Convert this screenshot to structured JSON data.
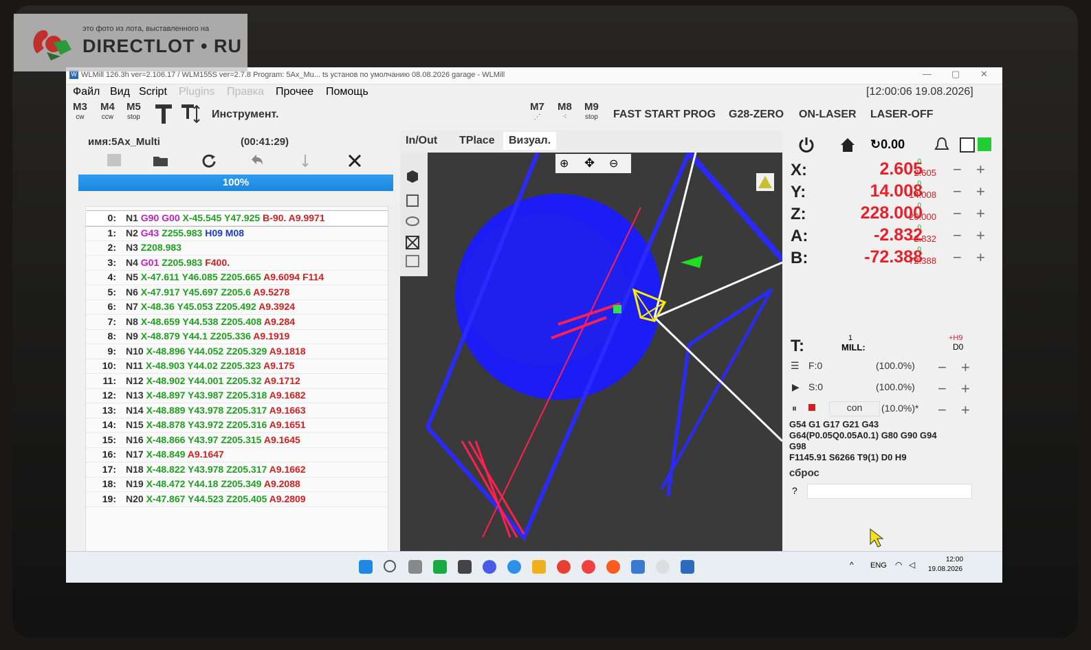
{
  "window": {
    "title": "WLMill 126.3h ver=2.106.17 / WLM155S ver=2.7.8   Program: 5Ax_Mu... ts установ по умолчанию 08.08.2026 garage - WLMill",
    "clock": "[12:00:06 19.08.2026]"
  },
  "menu": [
    "Файл",
    "Вид",
    "Script",
    "Plugins",
    "Правка",
    "Прочее",
    "Помощь"
  ],
  "toolbar": {
    "m3": "M3",
    "m3_sub": "cw",
    "m4": "M4",
    "m4_sub": "ccw",
    "m5": "M5",
    "m5_sub": "stop",
    "tool": "Инструмент.",
    "m7": "M7",
    "m8": "M8",
    "m9": "M9",
    "m9_sub": "stop",
    "fast_start": "FAST START PROG",
    "g28": "G28-ZERO",
    "on_laser": "ON-LASER",
    "laser_off": "LASER-OFF"
  },
  "program": {
    "name": "имя:5Ax_Multi",
    "time": "(00:41:29)",
    "progress": "100%",
    "progress_value": 1.0,
    "line_input": "0",
    "next_label": ">>>"
  },
  "code_lines": [
    {
      "n": "0:",
      "tokens": [
        [
          "N1",
          "n"
        ],
        [
          "G90",
          "g"
        ],
        [
          "G00",
          "g"
        ],
        [
          "X-45.545",
          "x"
        ],
        [
          "Y47.925",
          "y"
        ],
        [
          "B-90.",
          "b"
        ],
        [
          "A9.9971",
          "a"
        ]
      ]
    },
    {
      "n": "1:",
      "tokens": [
        [
          "N2",
          "n"
        ],
        [
          "G43",
          "g"
        ],
        [
          "Z255.983",
          "z"
        ],
        [
          "H09",
          "h"
        ],
        [
          "M08",
          "m"
        ]
      ]
    },
    {
      "n": "2:",
      "tokens": [
        [
          "N3",
          "n"
        ],
        [
          "Z208.983",
          "z"
        ]
      ]
    },
    {
      "n": "3:",
      "tokens": [
        [
          "N4",
          "n"
        ],
        [
          "G01",
          "g"
        ],
        [
          "Z205.983",
          "z"
        ],
        [
          "F400.",
          "f"
        ]
      ]
    },
    {
      "n": "4:",
      "tokens": [
        [
          "N5",
          "n"
        ],
        [
          "X-47.611",
          "x"
        ],
        [
          "Y46.085",
          "y"
        ],
        [
          "Z205.665",
          "z"
        ],
        [
          "A9.6094",
          "a"
        ],
        [
          "F114",
          "f"
        ]
      ]
    },
    {
      "n": "5:",
      "tokens": [
        [
          "N6",
          "n"
        ],
        [
          "X-47.917",
          "x"
        ],
        [
          "Y45.697",
          "y"
        ],
        [
          "Z205.6",
          "z"
        ],
        [
          "A9.5278",
          "a"
        ]
      ]
    },
    {
      "n": "6:",
      "tokens": [
        [
          "N7",
          "n"
        ],
        [
          "X-48.36",
          "x"
        ],
        [
          "Y45.053",
          "y"
        ],
        [
          "Z205.492",
          "z"
        ],
        [
          "A9.3924",
          "a"
        ]
      ]
    },
    {
      "n": "7:",
      "tokens": [
        [
          "N8",
          "n"
        ],
        [
          "X-48.659",
          "x"
        ],
        [
          "Y44.538",
          "y"
        ],
        [
          "Z205.408",
          "z"
        ],
        [
          "A9.284",
          "a"
        ]
      ]
    },
    {
      "n": "8:",
      "tokens": [
        [
          "N9",
          "n"
        ],
        [
          "X-48.879",
          "x"
        ],
        [
          "Y44.1",
          "y"
        ],
        [
          "Z205.336",
          "z"
        ],
        [
          "A9.1919",
          "a"
        ]
      ]
    },
    {
      "n": "9:",
      "tokens": [
        [
          "N10",
          "n"
        ],
        [
          "X-48.896",
          "x"
        ],
        [
          "Y44.052",
          "y"
        ],
        [
          "Z205.329",
          "z"
        ],
        [
          "A9.1818",
          "a"
        ]
      ]
    },
    {
      "n": "10:",
      "tokens": [
        [
          "N11",
          "n"
        ],
        [
          "X-48.903",
          "x"
        ],
        [
          "Y44.02",
          "y"
        ],
        [
          "Z205.323",
          "z"
        ],
        [
          "A9.175",
          "a"
        ]
      ]
    },
    {
      "n": "11:",
      "tokens": [
        [
          "N12",
          "n"
        ],
        [
          "X-48.902",
          "x"
        ],
        [
          "Y44.001",
          "y"
        ],
        [
          "Z205.32",
          "z"
        ],
        [
          "A9.1712",
          "a"
        ]
      ]
    },
    {
      "n": "12:",
      "tokens": [
        [
          "N13",
          "n"
        ],
        [
          "X-48.897",
          "x"
        ],
        [
          "Y43.987",
          "y"
        ],
        [
          "Z205.318",
          "z"
        ],
        [
          "A9.1682",
          "a"
        ]
      ]
    },
    {
      "n": "13:",
      "tokens": [
        [
          "N14",
          "n"
        ],
        [
          "X-48.889",
          "x"
        ],
        [
          "Y43.978",
          "y"
        ],
        [
          "Z205.317",
          "z"
        ],
        [
          "A9.1663",
          "a"
        ]
      ]
    },
    {
      "n": "14:",
      "tokens": [
        [
          "N15",
          "n"
        ],
        [
          "X-48.878",
          "x"
        ],
        [
          "Y43.972",
          "y"
        ],
        [
          "Z205.316",
          "z"
        ],
        [
          "A9.1651",
          "a"
        ]
      ]
    },
    {
      "n": "15:",
      "tokens": [
        [
          "N16",
          "n"
        ],
        [
          "X-48.866",
          "x"
        ],
        [
          "Y43.97",
          "y"
        ],
        [
          "Z205.315",
          "z"
        ],
        [
          "A9.1645",
          "a"
        ]
      ]
    },
    {
      "n": "16:",
      "tokens": [
        [
          "N17",
          "n"
        ],
        [
          "X-48.849",
          "x"
        ],
        [
          "A9.1647",
          "a"
        ]
      ]
    },
    {
      "n": "17:",
      "tokens": [
        [
          "N18",
          "n"
        ],
        [
          "X-48.822",
          "x"
        ],
        [
          "Y43.978",
          "y"
        ],
        [
          "Z205.317",
          "z"
        ],
        [
          "A9.1662",
          "a"
        ]
      ]
    },
    {
      "n": "18:",
      "tokens": [
        [
          "N19",
          "n"
        ],
        [
          "X-48.472",
          "x"
        ],
        [
          "Y44.18",
          "y"
        ],
        [
          "Z205.349",
          "z"
        ],
        [
          "A9.2088",
          "a"
        ]
      ]
    },
    {
      "n": "19:",
      "tokens": [
        [
          "N20",
          "n"
        ],
        [
          "X-47.867",
          "x"
        ],
        [
          "Y44.523",
          "y"
        ],
        [
          "Z205.405",
          "z"
        ],
        [
          "A9.2809",
          "a"
        ]
      ]
    }
  ],
  "tabs": [
    "In/Out",
    "TPlace",
    "Визуал."
  ],
  "right": {
    "feed_override": "0.00",
    "axes": [
      {
        "label": "X:",
        "value": "2.605",
        "sub": "2.605",
        "flag": "0"
      },
      {
        "label": "Y:",
        "value": "14.008",
        "sub": "14.008",
        "flag": "0"
      },
      {
        "label": "Z:",
        "value": "228.000",
        "sub": "20.000",
        "flag": "0"
      },
      {
        "label": "A:",
        "value": "-2.832",
        "sub": "-2.832",
        "flag": "0"
      },
      {
        "label": "B:",
        "value": "-72.388",
        "sub": "-72.388",
        "flag": "0"
      }
    ],
    "tool": {
      "label": "T:",
      "num": "1",
      "name": "MILL:",
      "h": "+H9",
      "d": "D0"
    },
    "f": {
      "label": "F:0",
      "pct": "(100.0%)"
    },
    "s": {
      "label": "S:0",
      "pct": "(100.0%)"
    },
    "con": {
      "label": "con",
      "pct": "(10.0%)*"
    },
    "gstate": [
      "G54 G1 G17 G21 G43",
      "G64(P0.05Q0.05A0.1) G80 G90 G94",
      "G98",
      "F1145.91 S6266 T9(1) D0 H9"
    ],
    "reset": "сброс",
    "help": "?"
  },
  "taskbar": {
    "lang": "ENG",
    "time": "12:00",
    "date": "19.08.2026"
  },
  "watermark": {
    "small": "это фото из лота, выставленного на",
    "big": "DIRECTLOT • RU"
  },
  "colors": {
    "accent": "#1c86de",
    "value_red": "#e8202a",
    "viz_blue": "#1a1aff",
    "viz_red": "#ff2050"
  }
}
